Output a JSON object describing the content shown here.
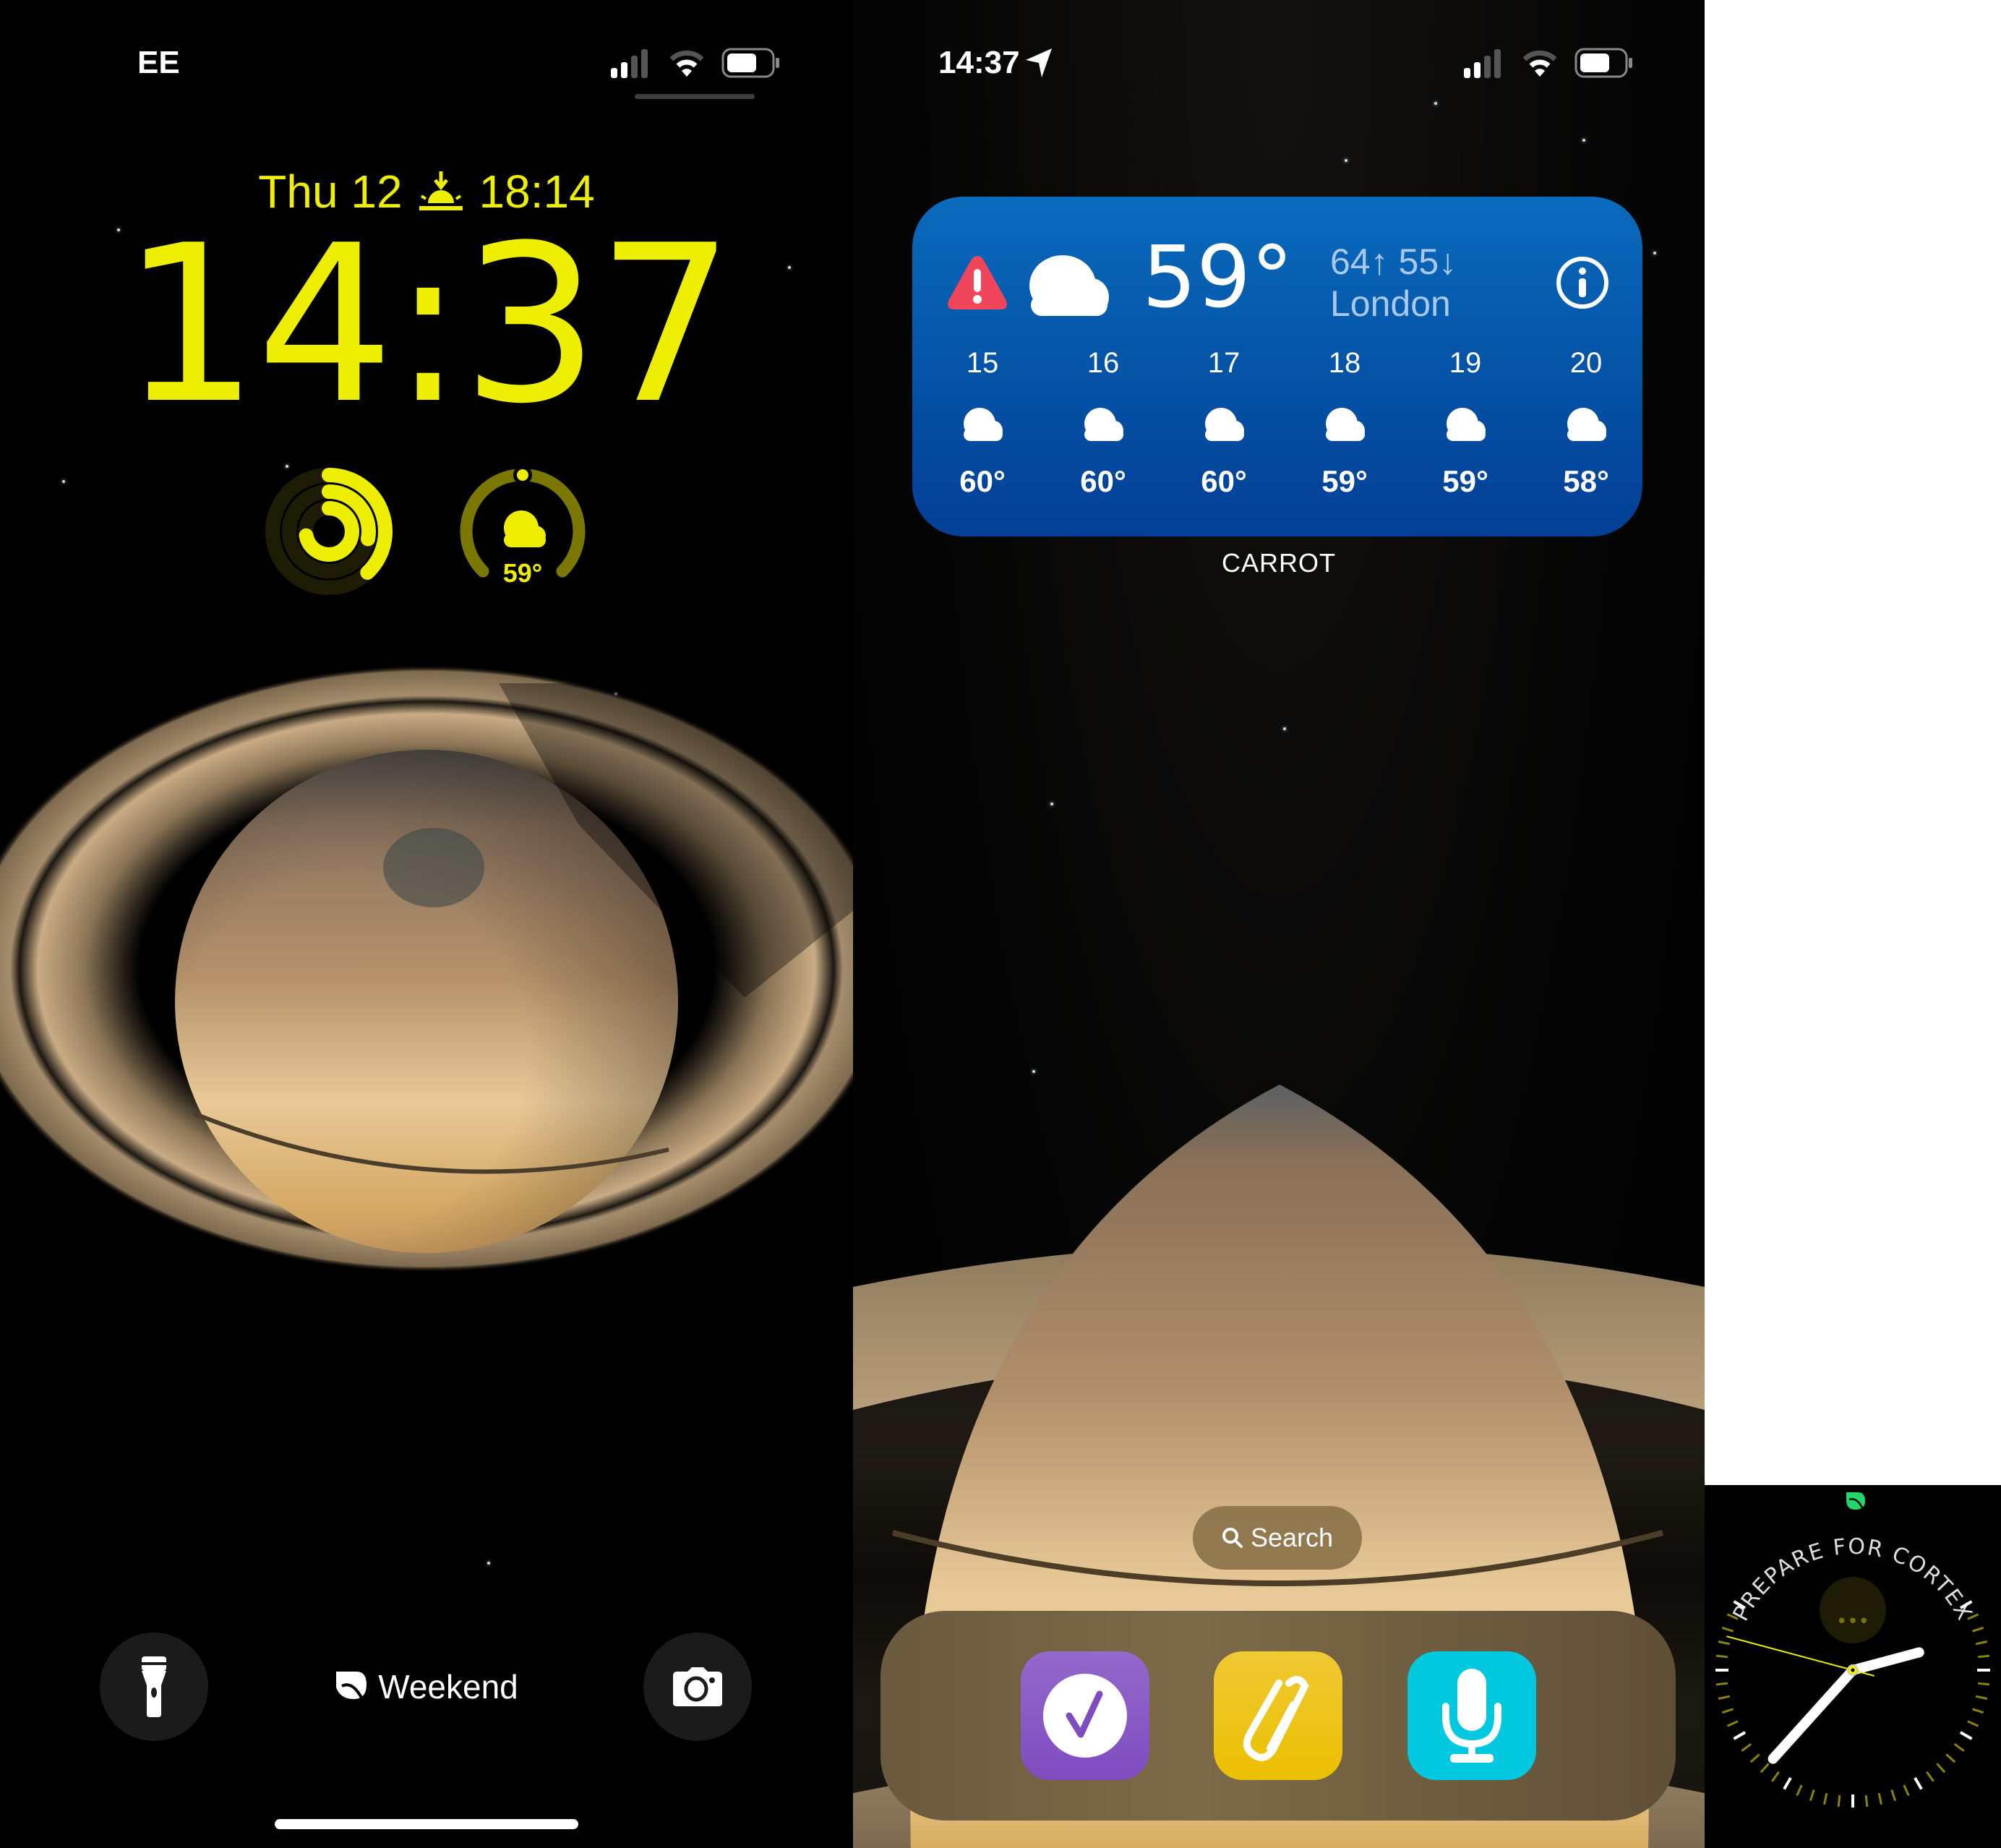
{
  "lock_screen": {
    "status_bar": {
      "carrier": "EE",
      "signal_bars": 2,
      "signal_total": 4,
      "wifi_icon": "wifi-icon",
      "battery_icon": "battery-icon"
    },
    "date_line": {
      "date": "Thu 12",
      "sunset_icon": "sunset-icon",
      "sunset_time": "18:14"
    },
    "time": "14:37",
    "widgets": {
      "activity_rings": {
        "icon": "activity-rings",
        "move_fraction": 0.38,
        "exercise_fraction": 0.28,
        "stand_fraction": 0.72
      },
      "weather_gauge": {
        "icon": "cloud-icon",
        "temperature": "59°",
        "gauge_fraction": 0.5
      }
    },
    "focus_label": "Weekend",
    "focus_icon": "leaf-icon",
    "buttons": {
      "flashlight": "flashlight-icon",
      "camera": "camera-icon"
    },
    "accent_color": "#EEEE00"
  },
  "home_screen": {
    "status_bar": {
      "time": "14:37",
      "location_icon": "location-arrow-icon",
      "signal_bars": 2,
      "signal_total": 4
    },
    "weather_widget": {
      "app_name": "CARROT",
      "alert_icon": "warning-icon",
      "condition_icon": "cloud-icon",
      "current_temp": "59°",
      "high_low": "64↑ 55↓",
      "location": "London",
      "info_icon": "info-icon",
      "forecast": [
        {
          "day": "15",
          "icon": "cloud-icon",
          "temp": "60°"
        },
        {
          "day": "16",
          "icon": "cloud-icon",
          "temp": "60°"
        },
        {
          "day": "17",
          "icon": "cloud-icon",
          "temp": "60°"
        },
        {
          "day": "18",
          "icon": "cloud-icon",
          "temp": "59°"
        },
        {
          "day": "19",
          "icon": "cloud-icon",
          "temp": "59°"
        },
        {
          "day": "20",
          "icon": "cloud-icon",
          "temp": "58°"
        }
      ],
      "colors": {
        "top": "#0a6bbd",
        "bottom": "#033f96",
        "alert": "#f0455a",
        "secondary_text": "#a8c8ec"
      }
    },
    "search_label": "Search",
    "dock_apps": [
      {
        "name": "tasks-app",
        "icon": "checkmark-icon",
        "color": "#8a5cc8"
      },
      {
        "name": "clipboard-app",
        "icon": "paperclip-icon",
        "color": "#ecc20a"
      },
      {
        "name": "voice-app",
        "icon": "microphone-icon",
        "color": "#00c8de"
      }
    ]
  },
  "watch_face": {
    "complication_icon": "leaf-icon",
    "curved_text": "PREPARE FOR CORTEX",
    "center_complication": "•••",
    "hour_angle_deg": 75,
    "minute_angle_deg": 222,
    "second_angle_deg": 285,
    "accent_color": "#EEEE00"
  }
}
